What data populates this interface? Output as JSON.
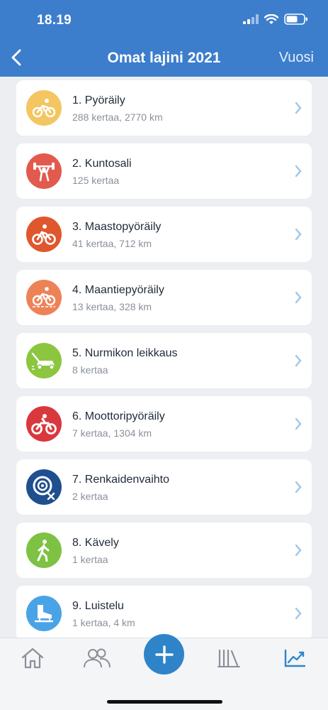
{
  "status_bar": {
    "time": "18.19"
  },
  "nav": {
    "title": "Omat lajini 2021",
    "right_label": "Vuosi"
  },
  "items": [
    {
      "title": "1. Pyöräily",
      "subtitle": "288 kertaa, 2770 km",
      "icon": "bicycle-icon",
      "color": "#f3c661"
    },
    {
      "title": "2. Kuntosali",
      "subtitle": "125 kertaa",
      "icon": "weightlifting-icon",
      "color": "#e25a4e"
    },
    {
      "title": "3. Maastopyöräily",
      "subtitle": "41 kertaa, 712 km",
      "icon": "mountain-bike-icon",
      "color": "#e0572e"
    },
    {
      "title": "4. Maantiepyöräily",
      "subtitle": "13 kertaa, 328 km",
      "icon": "road-bike-icon",
      "color": "#ee8257"
    },
    {
      "title": "5. Nurmikon leikkaus",
      "subtitle": "8 kertaa",
      "icon": "lawn-mower-icon",
      "color": "#8cc63f"
    },
    {
      "title": "6. Moottoripyöräily",
      "subtitle": "7 kertaa, 1304 km",
      "icon": "motorcycle-icon",
      "color": "#d9383d"
    },
    {
      "title": "7. Renkaidenvaihto",
      "subtitle": "2 kertaa",
      "icon": "tire-change-icon",
      "color": "#1f4f8f"
    },
    {
      "title": "8. Kävely",
      "subtitle": "1 kertaa",
      "icon": "walking-icon",
      "color": "#7dc242"
    },
    {
      "title": "9. Luistelu",
      "subtitle": "1 kertaa, 4 km",
      "icon": "ice-skate-icon",
      "color": "#4aa3e6"
    }
  ],
  "tabbar": {
    "tabs": [
      "home-icon",
      "friends-icon",
      "add-icon",
      "library-icon",
      "stats-icon"
    ],
    "active": "stats-icon",
    "accent": "#2f84c9"
  }
}
